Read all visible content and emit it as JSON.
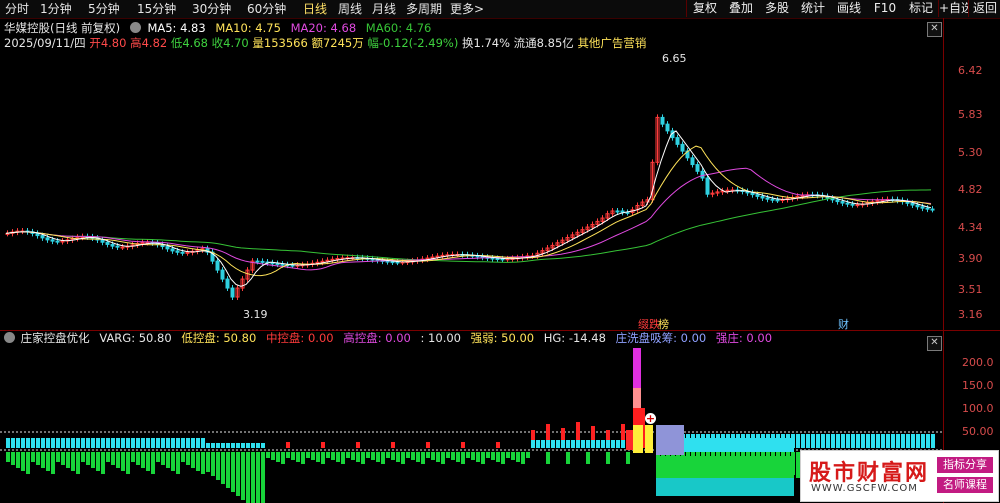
{
  "toolbar": {
    "periods": [
      "分时",
      "1分钟",
      "5分钟",
      "15分钟",
      "30分钟",
      "60分钟",
      "日线",
      "周线",
      "月线",
      "多周期",
      "更多"
    ],
    "active_period": "日线",
    "more_arrow": ">",
    "right_buttons": [
      "复权",
      "叠加",
      "多股",
      "统计",
      "画线",
      "F10",
      "标记",
      "+自选",
      "返回"
    ]
  },
  "quote": {
    "title": "华媒控股(日线 前复权)",
    "ma5": "MA5: 4.83",
    "ma10": "MA10: 4.75",
    "ma20": "MA20: 4.68",
    "ma60": "MA60: 4.76",
    "date": "2025/09/11/四",
    "open": "开4.80",
    "high": "高4.82",
    "low": "低4.68",
    "close": "收4.70",
    "volume": "量153566",
    "amount": "额7245万",
    "change": "幅-0.12(-2.49%)",
    "turnover": "换1.74%",
    "float": "流通8.85亿",
    "concept": "其他广告营销"
  },
  "price_axis": [
    "6.42",
    "5.83",
    "5.30",
    "4.82",
    "4.34",
    "3.90",
    "3.51",
    "3.16"
  ],
  "annotations": {
    "high": "6.65",
    "low": "3.19",
    "tag_a": "缀跌",
    "tag_b": "榜",
    "tag_c": "财"
  },
  "indicator": {
    "name": "庄家控盘优化",
    "varg": "VARG: 50.80",
    "low_ctrl": "低控盘: 50.80",
    "mid_ctrl": "中控盘: 0.00",
    "high_ctrl": "高控盘: 0.00",
    "ten": ": 10.00",
    "strength": "强弱: 50.00",
    "hg": "HG: -14.48",
    "wash": "庄洗盘吸筹: 0.00",
    "strong": "强庄: 0.00",
    "axis": [
      "200.0",
      "150.0",
      "100.0",
      "50.00"
    ],
    "marker": "+"
  },
  "colors": {
    "up": "#ff3b3b",
    "down": "#2fd0e0",
    "ma5": "#ffffff",
    "ma10": "#ffe35a",
    "ma20": "#e04ae0",
    "ma60": "#36c236",
    "axis": "#d84c4c"
  },
  "watermark": {
    "title": "股市财富网",
    "url": "WWW.GSCFW.COM",
    "tag1": "指标分享",
    "tag2": "名师课程"
  }
}
